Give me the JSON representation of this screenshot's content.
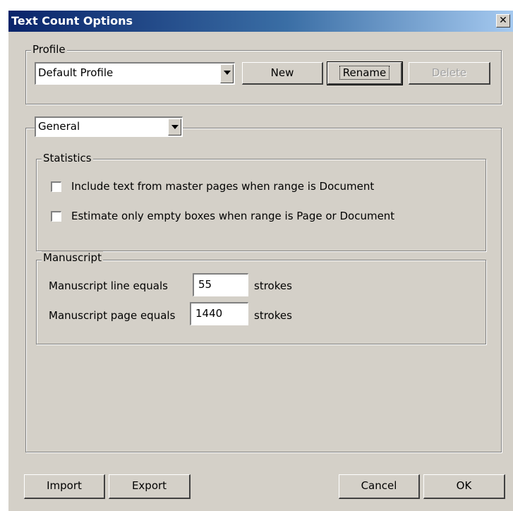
{
  "window": {
    "title": "Text Count Options",
    "close_symbol": "✕"
  },
  "profile": {
    "group_label": "Profile",
    "selected": "Default Profile",
    "new_label": "New",
    "rename_label": "Rename",
    "delete_label": "Delete"
  },
  "section_select": {
    "selected": "General"
  },
  "statistics": {
    "group_label": "Statistics",
    "include_master_label": "Include text from master pages when range is Document",
    "include_master_checked": false,
    "estimate_empty_label": "Estimate only empty boxes when range is Page or Document",
    "estimate_empty_checked": false
  },
  "manuscript": {
    "group_label": "Manuscript",
    "line_label": "Manuscript line equals",
    "line_value": "55",
    "page_label": "Manuscript page equals",
    "page_value": "1440",
    "unit_label": "strokes"
  },
  "footer": {
    "import_label": "Import",
    "export_label": "Export",
    "cancel_label": "Cancel",
    "ok_label": "OK"
  },
  "colors": {
    "title_gradient_start": "#0a246a",
    "title_gradient_end": "#a6caf0",
    "dialog_bg": "#d4d0c8"
  }
}
